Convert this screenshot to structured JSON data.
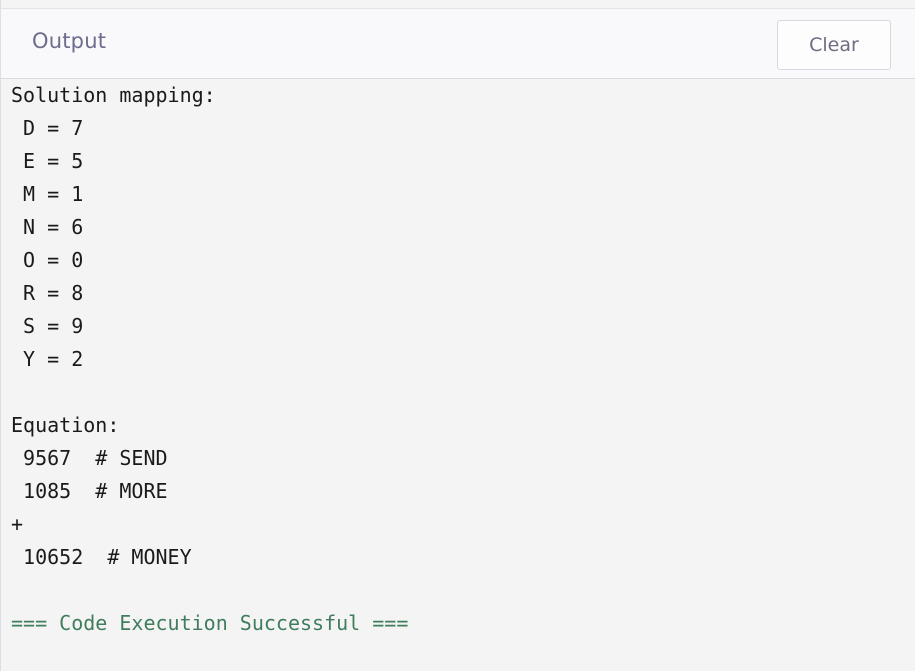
{
  "header": {
    "title": "Output",
    "clear_label": "Clear"
  },
  "output": {
    "lines": [
      "Solution mapping:",
      " D = 7",
      " E = 5",
      " M = 1",
      " N = 6",
      " O = 0",
      " R = 8",
      " S = 9",
      " Y = 2",
      "",
      "Equation:",
      " 9567  # SEND",
      " 1085  # MORE",
      "+",
      " 10652  # MONEY",
      ""
    ],
    "status": "=== Code Execution Successful ==="
  },
  "colors": {
    "background": "#f4f4f4",
    "header_background": "#f9f9fb",
    "title": "#6c6c8c",
    "success": "#3f7d5c"
  }
}
